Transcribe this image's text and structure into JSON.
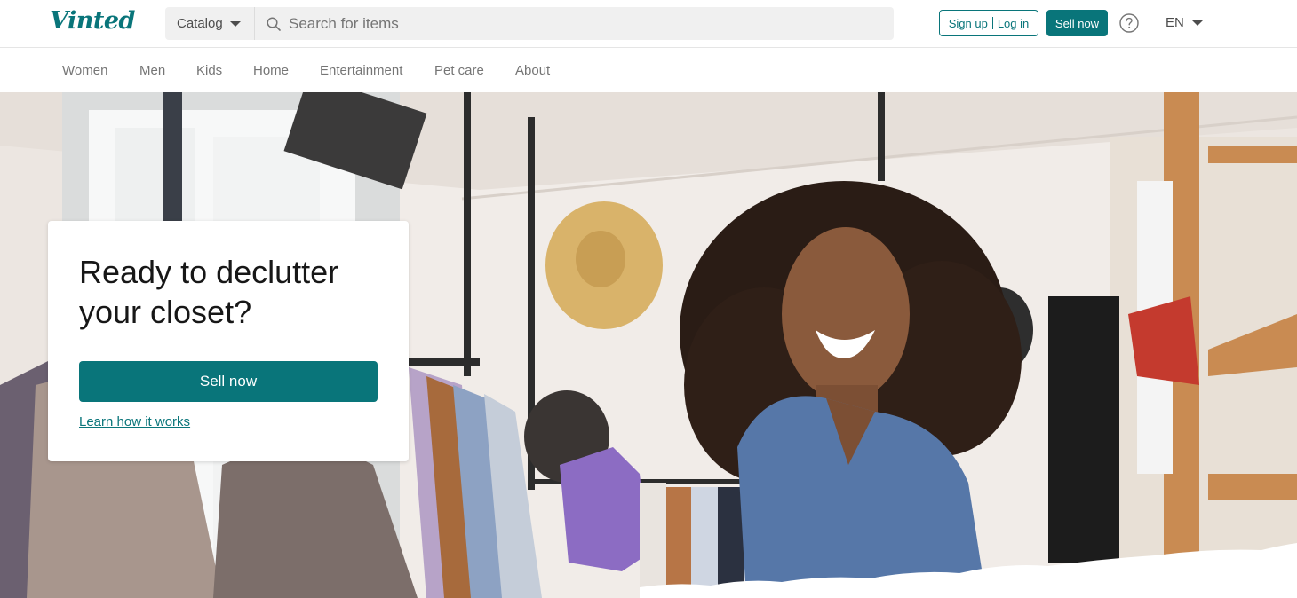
{
  "header": {
    "logo": "Vinted",
    "catalog_label": "Catalog",
    "search_placeholder": "Search for items",
    "signup_label": "Sign up",
    "login_label": "Log in",
    "sell_now_label": "Sell now",
    "language": "EN"
  },
  "nav": {
    "items": [
      {
        "label": "Women"
      },
      {
        "label": "Men"
      },
      {
        "label": "Kids"
      },
      {
        "label": "Home"
      },
      {
        "label": "Entertainment"
      },
      {
        "label": "Pet care"
      },
      {
        "label": "About"
      }
    ]
  },
  "hero": {
    "title": "Ready to declutter your closet?",
    "sell_now_label": "Sell now",
    "learn_link": "Learn how it works"
  },
  "colors": {
    "brand": "#09757a",
    "text": "#171717",
    "muted": "#757575"
  }
}
